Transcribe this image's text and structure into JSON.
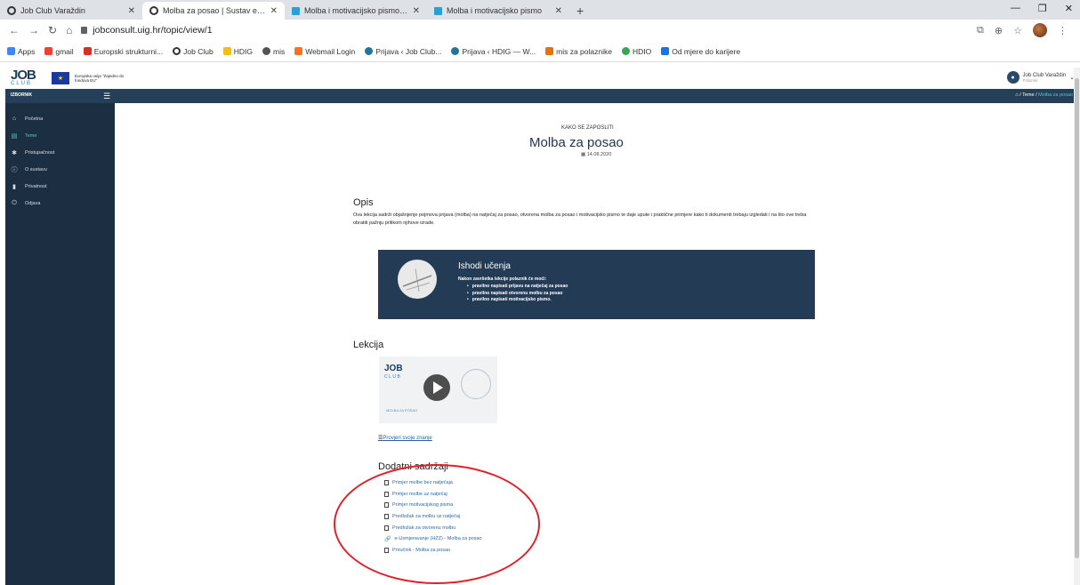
{
  "browser": {
    "tabs": [
      {
        "title": "Job Club Varaždin",
        "icon": "circle-logo-icon"
      },
      {
        "title": "Molba za posao | Sustav e-učenja",
        "icon": "circle-logo-icon",
        "active": true
      },
      {
        "title": "Molba i motivacijsko pismo - kvi...",
        "icon": "bank-icon"
      },
      {
        "title": "Molba i motivacijsko pismo",
        "icon": "bank-icon"
      }
    ],
    "new_tab": "+",
    "url": "jobconsult.uig.hr/topic/view/1",
    "bookmarks": [
      "Apps",
      "gmail",
      "Europski strukturni...",
      "Job Club",
      "HDIG",
      "mis",
      "Webmail Login",
      "Prijava ‹ Job Club...",
      "Prijava ‹ HDIG — W...",
      "mis za polaznike",
      "HDIO",
      "Od mjere do karijere"
    ]
  },
  "header": {
    "logo_job": "JOB",
    "logo_club": "CLUB",
    "eu_text": "Europska unija \"Zajedno do fondova EU\"",
    "user_name": "Job Club Varaždin",
    "user_role": "Polaznik"
  },
  "nav": {
    "menu_title": "IZBORNIK",
    "breadcrumb_sep": "/",
    "breadcrumb_1": "Teme",
    "breadcrumb_2": "Molba za posao"
  },
  "sidebar": {
    "items": [
      {
        "label": "Početna",
        "icon": "home-icon"
      },
      {
        "label": "Teme",
        "icon": "book-icon"
      },
      {
        "label": "Pristupačnost",
        "icon": "gear-icon"
      },
      {
        "label": "O sustavu",
        "icon": "info-icon"
      },
      {
        "label": "Privatnost",
        "icon": "file-icon"
      },
      {
        "label": "Odjava",
        "icon": "power-icon"
      }
    ]
  },
  "topic": {
    "kicker": "KAKO SE ZAPOSLITI",
    "title": "Molba za posao",
    "date": "14.08.2020",
    "opis_heading": "Opis",
    "opis_text": "Ova lekcija sadrži objašnjenje pojmova prijava (molba) na natječaj za posao, otvorena molba za posao i motivacijsko pismo te daje upute i praktične primjere kako ti dokumenti trebaju izgledati i na što ove treba obratiti pažnju prilikom njihove izrade.",
    "outcomes_heading": "Ishodi učenja",
    "outcomes_intro": "Nakon završetka lekcije polaznik će moći:",
    "outcomes": [
      "pravilno napisati prijavu na natječaj za posao",
      "pravilno napisati otvorenu molbu za posao",
      "pravilno napisati motivacijsko pismo."
    ],
    "lesson_heading": "Lekcija",
    "video_caption": "MOLBA ZA POSAO",
    "quiz_link": "Provjeri svoje znanje",
    "extras_heading": "Dodatni sadržaji",
    "extras": [
      {
        "label": "Primjer molbe bez natječaja",
        "icon": "document-icon"
      },
      {
        "label": "Primjer molbe uz natječaj",
        "icon": "document-icon"
      },
      {
        "label": "Primjer motivacijskog pisma",
        "icon": "document-icon"
      },
      {
        "label": "Predložak za molbu uz natječaj",
        "icon": "document-icon"
      },
      {
        "label": "Predložak za otvorenu molbu",
        "icon": "document-icon"
      },
      {
        "label": "e-Usmjeravanje (HZZ) - Molba za posao",
        "icon": "link-icon"
      },
      {
        "label": "Priručnik - Molba za posao",
        "icon": "document-icon"
      }
    ]
  },
  "colors": {
    "nav_bg": "#263f58",
    "sidebar_bg": "#1c2f42",
    "accent": "#4fd1c5",
    "annotation_oval": "#e0202a"
  }
}
